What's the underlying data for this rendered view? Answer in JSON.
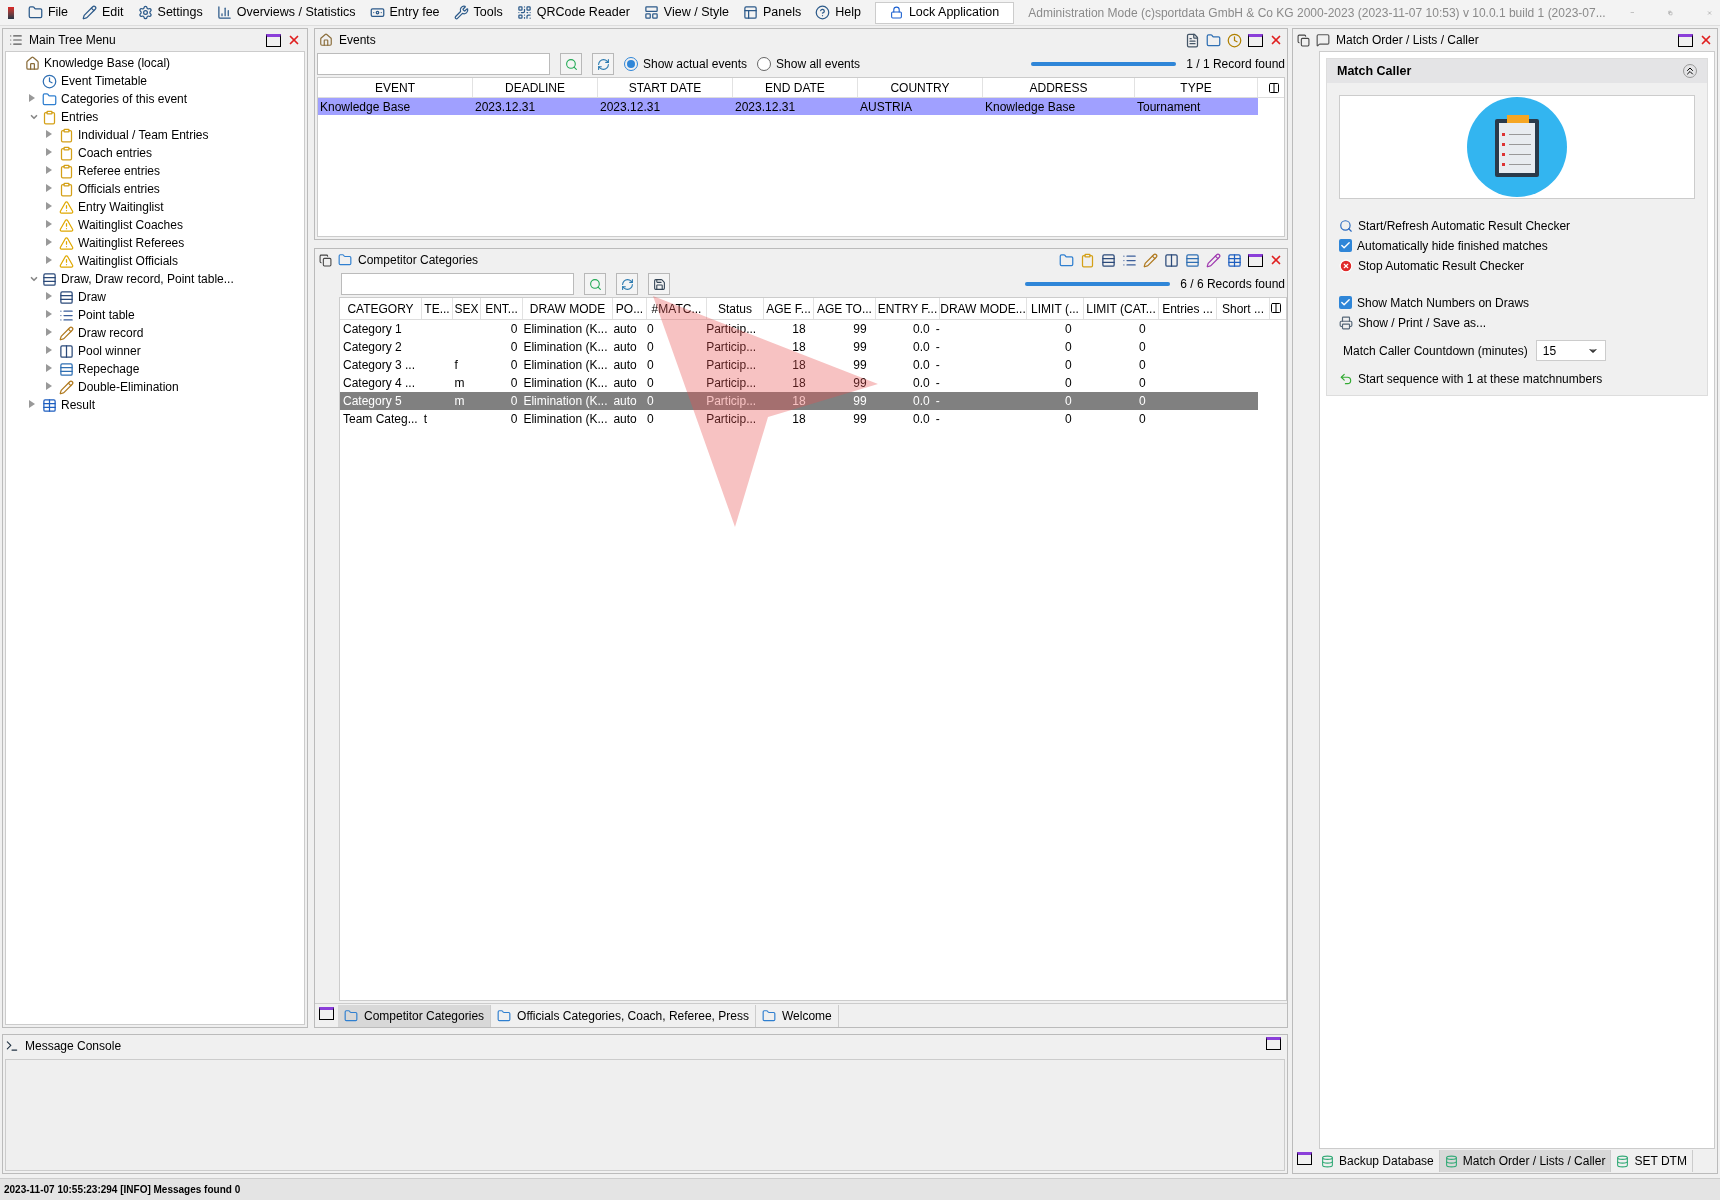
{
  "menu_bar": {
    "items": [
      "File",
      "Edit",
      "Settings",
      "Overviews / Statistics",
      "Entry fee",
      "Tools",
      "QRCode Reader",
      "View / Style",
      "Panels",
      "Help"
    ],
    "lock_button": "Lock Application",
    "title": "Administration Mode (c)sportdata GmbH & Co KG 2000-2023 (2023-11-07 10:53)  v 10.0.1 build 1 (2023-07..."
  },
  "tree_panel": {
    "title": "Main Tree Menu",
    "items": [
      {
        "label": "Knowledge Base (local)",
        "kind": "house",
        "children": [
          {
            "label": "Event Timetable",
            "kind": "clock"
          },
          {
            "label": "Categories of this event",
            "kind": "folder",
            "expanded": false
          },
          {
            "label": "Entries",
            "kind": "clipboard",
            "expanded": true,
            "children": [
              {
                "label": "Individual / Team Entries",
                "kind": "clipboard",
                "expanded": false
              },
              {
                "label": "Coach entries",
                "kind": "clipboard",
                "expanded": false
              },
              {
                "label": "Referee entries",
                "kind": "clipboard",
                "expanded": false
              },
              {
                "label": "Officials entries",
                "kind": "clipboard",
                "expanded": false
              },
              {
                "label": "Entry Waitinglist",
                "kind": "warning",
                "expanded": false
              },
              {
                "label": "Waitinglist Coaches",
                "kind": "warning",
                "expanded": false
              },
              {
                "label": "Waitinglist Referees",
                "kind": "warning",
                "expanded": false
              },
              {
                "label": "Waitinglist Officials",
                "kind": "warning",
                "expanded": false
              }
            ]
          },
          {
            "label": "Draw, Draw record, Point table...",
            "kind": "draw",
            "expanded": true,
            "children": [
              {
                "label": "Draw",
                "kind": "draw",
                "expanded": false
              },
              {
                "label": "Point table",
                "kind": "list",
                "expanded": false
              },
              {
                "label": "Draw record",
                "kind": "pencil",
                "expanded": false
              },
              {
                "label": "Pool winner",
                "kind": "columns",
                "expanded": false
              },
              {
                "label": "Repechage",
                "kind": "rows",
                "expanded": false
              },
              {
                "label": "Double-Elimination",
                "kind": "pencil",
                "expanded": false
              }
            ]
          },
          {
            "label": "Result",
            "kind": "table",
            "expanded": false
          }
        ]
      }
    ]
  },
  "events": {
    "title": "Events",
    "radios": [
      {
        "label": "Show actual events",
        "selected": true
      },
      {
        "label": "Show all events",
        "selected": false
      }
    ],
    "progress": {
      "level": 1
    },
    "record_count": "1 / 1 Record found",
    "columns": [
      "EVENT",
      "DEADLINE",
      "START DATE",
      "END DATE",
      "COUNTRY",
      "ADDRESS",
      "TYPE"
    ],
    "rows": [
      {
        "cells": [
          "Knowledge Base",
          "2023.12.31",
          "2023.12.31",
          "2023.12.31",
          "AUSTRIA",
          "Knowledge Base",
          "Tournament"
        ],
        "selected": true
      }
    ]
  },
  "categories": {
    "title": "Competitor Categories",
    "progress": {
      "level": 1
    },
    "record_count": "6 / 6 Records found",
    "columns": [
      "CATEGORY",
      "TE...",
      "SEX",
      "ENT...",
      "DRAW MODE",
      "PO...",
      "#MATC...",
      "Status",
      "AGE F...",
      "AGE TO...",
      "ENTRY F...",
      "DRAW MODE...",
      "LIMIT (...",
      "LIMIT (CAT...",
      "Entries ...",
      "Short ..."
    ],
    "rows": [
      {
        "cells": [
          "Category 1",
          null,
          null,
          "0",
          "Elimination (K...",
          "auto",
          "0",
          "Particip...",
          "18",
          "99",
          "0.0",
          "-",
          "0",
          "0",
          null,
          null
        ],
        "selected": false
      },
      {
        "cells": [
          "Category 2",
          null,
          null,
          "0",
          "Elimination (K...",
          "auto",
          "0",
          "Particip...",
          "18",
          "99",
          "0.0",
          "-",
          "0",
          "0",
          null,
          null
        ],
        "selected": false
      },
      {
        "cells": [
          "Category 3 ...",
          null,
          "f",
          "0",
          "Elimination (K...",
          "auto",
          "0",
          "Particip...",
          "18",
          "99",
          "0.0",
          "-",
          "0",
          "0",
          null,
          null
        ],
        "selected": false
      },
      {
        "cells": [
          "Category 4 ...",
          null,
          "m",
          "0",
          "Elimination (K...",
          "auto",
          "0",
          "Particip...",
          "18",
          "99",
          "0.0",
          "-",
          "0",
          "0",
          null,
          null
        ],
        "selected": false
      },
      {
        "cells": [
          "Category 5",
          null,
          "m",
          "0",
          "Elimination (K...",
          "auto",
          "0",
          "Particip...",
          "18",
          "99",
          "0.0",
          "-",
          "0",
          "0",
          null,
          null
        ],
        "selected": true
      },
      {
        "cells": [
          "Team Categ...",
          "t",
          null,
          "0",
          "Elimination (K...",
          "auto",
          "0",
          "Particip...",
          "18",
          "99",
          "0.0",
          "-",
          "0",
          "0",
          null,
          null
        ],
        "selected": false
      }
    ],
    "tabs": [
      {
        "label": "Competitor Categories",
        "selected": true
      },
      {
        "label": "Officials Categories, Coach, Referee, Press",
        "selected": false
      },
      {
        "label": "Welcome",
        "selected": false
      }
    ]
  },
  "message_console": {
    "title": "Message Console"
  },
  "right_panel": {
    "title": "Match Order / Lists / Caller",
    "section_title": "Match Caller",
    "actions": [
      {
        "kind": "action",
        "label": "Start/Refresh Automatic Result Checker"
      },
      {
        "kind": "checkbox",
        "label": "Automatically hide finished matches",
        "checked": true
      },
      {
        "kind": "stop",
        "label": "Stop Automatic Result Checker"
      },
      {
        "kind": "spacer"
      },
      {
        "kind": "checkbox",
        "label": "Show Match Numbers on Draws",
        "checked": true
      },
      {
        "kind": "print",
        "label": "Show / Print / Save as..."
      }
    ],
    "countdown": {
      "label": "Match Caller Countdown (minutes)",
      "value": "15"
    },
    "sequence": "Start sequence with 1 at these matchnumbers",
    "tabs": [
      {
        "label": "Backup Database",
        "selected": false
      },
      {
        "label": "Match Order / Lists / Caller",
        "selected": true
      },
      {
        "label": "SET DTM",
        "selected": false
      }
    ]
  },
  "status_bar": "2023-11-07 10:55:23:294 [INFO] Messages found 0"
}
